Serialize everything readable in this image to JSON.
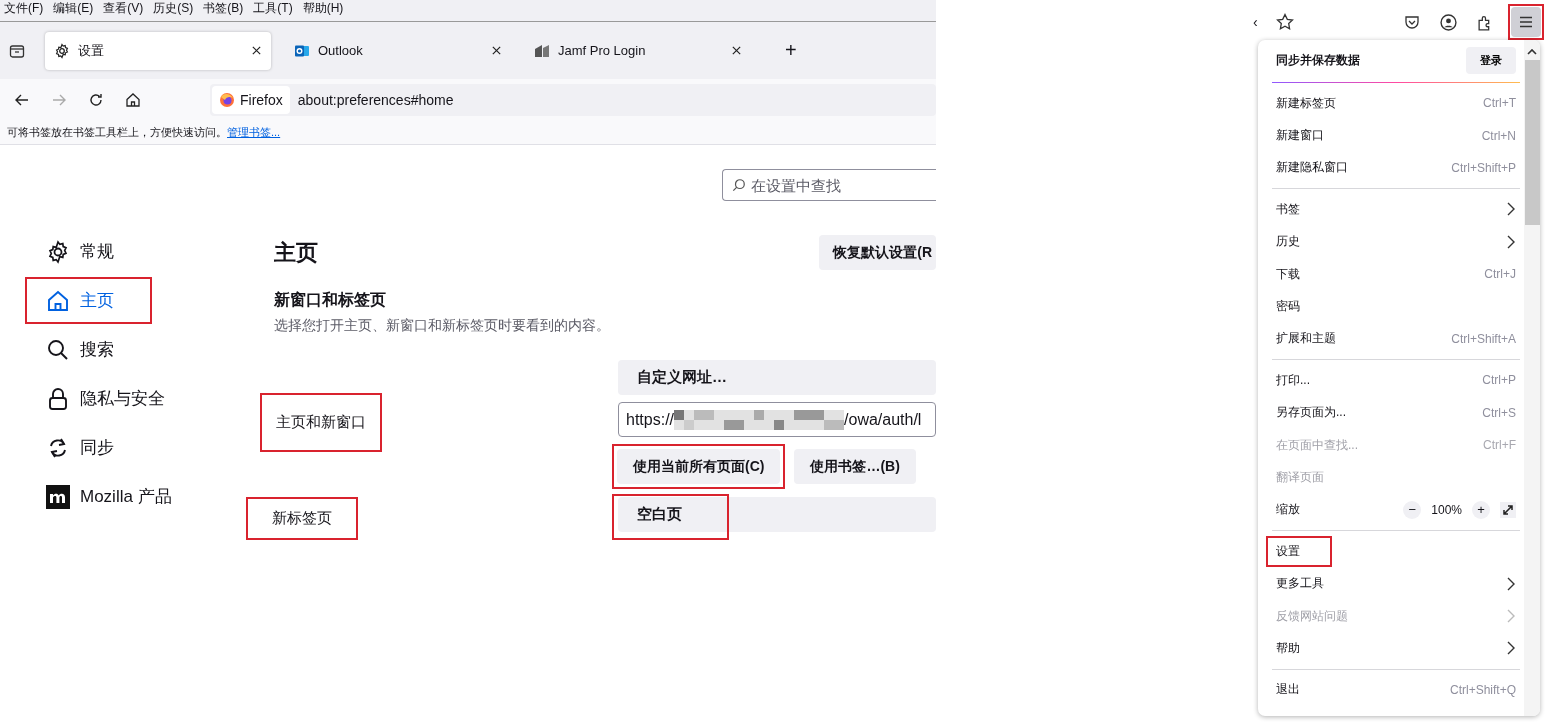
{
  "menubar": [
    "文件(F)",
    "编辑(E)",
    "查看(V)",
    "历史(S)",
    "书签(B)",
    "工具(T)",
    "帮助(H)"
  ],
  "tabs": [
    {
      "label": "设置",
      "selected": true
    },
    {
      "label": "Outlook",
      "selected": false
    },
    {
      "label": "Jamf Pro Login",
      "selected": false
    }
  ],
  "new_tab": "+",
  "address_bar": {
    "identity": "Firefox",
    "url": "about:preferences#home"
  },
  "bookmarks_bar": {
    "text": "可将书签放在书签工具栏上，方便快速访问。",
    "link": "管理书签..."
  },
  "search": {
    "placeholder": "在设置中查找"
  },
  "sidebar": [
    {
      "label": "常规",
      "selected": false,
      "highlighted": false
    },
    {
      "label": "主页",
      "selected": true,
      "highlighted": true
    },
    {
      "label": "搜索",
      "selected": false,
      "highlighted": false
    },
    {
      "label": "隐私与安全",
      "selected": false,
      "highlighted": false
    },
    {
      "label": "同步",
      "selected": false,
      "highlighted": false
    },
    {
      "label": "Mozilla 产品",
      "selected": false,
      "highlighted": false
    }
  ],
  "main": {
    "title": "主页",
    "restore_button": "恢复默认设置(R",
    "section_title": "新窗口和标签页",
    "description": "选择您打开主页、新窗口和新标签页时要看到的内容。",
    "homepage_row": {
      "label": "主页和新窗口",
      "highlighted": true,
      "dropdown": "自定义网址…",
      "url_prefix": "https://",
      "url_suffix": "/owa/auth/l",
      "url_redacted": true,
      "buttons": [
        {
          "label": "使用当前所有页面(C)",
          "highlighted": true
        },
        {
          "label": "使用书签…(B)",
          "highlighted": false
        }
      ]
    },
    "newtab_row": {
      "label": "新标签页",
      "highlighted": true,
      "dropdown": "空白页",
      "dropdown_highlighted": true
    }
  },
  "toolbar": {
    "overflow": "‹"
  },
  "menu": {
    "highlighted_button": true,
    "sync": {
      "title": "同步并保存数据",
      "button": "登录"
    },
    "items": [
      {
        "kind": "item",
        "label": "新建标签页",
        "shortcut": "Ctrl+T",
        "disabled": false,
        "submenu": false,
        "highlighted": false
      },
      {
        "kind": "item",
        "label": "新建窗口",
        "shortcut": "Ctrl+N",
        "disabled": false,
        "submenu": false,
        "highlighted": false
      },
      {
        "kind": "item",
        "label": "新建隐私窗口",
        "shortcut": "Ctrl+Shift+P",
        "disabled": false,
        "submenu": false,
        "highlighted": false
      },
      {
        "kind": "separator"
      },
      {
        "kind": "item",
        "label": "书签",
        "disabled": false,
        "submenu": true,
        "highlighted": false
      },
      {
        "kind": "item",
        "label": "历史",
        "disabled": false,
        "submenu": true,
        "highlighted": false
      },
      {
        "kind": "item",
        "label": "下载",
        "shortcut": "Ctrl+J",
        "disabled": false,
        "submenu": false,
        "highlighted": false
      },
      {
        "kind": "item",
        "label": "密码",
        "disabled": false,
        "submenu": false,
        "highlighted": false
      },
      {
        "kind": "item",
        "label": "扩展和主题",
        "shortcut": "Ctrl+Shift+A",
        "disabled": false,
        "submenu": false,
        "highlighted": false
      },
      {
        "kind": "separator"
      },
      {
        "kind": "item",
        "label": "打印...",
        "shortcut": "Ctrl+P",
        "disabled": false,
        "submenu": false,
        "highlighted": false
      },
      {
        "kind": "item",
        "label": "另存页面为...",
        "shortcut": "Ctrl+S",
        "disabled": false,
        "submenu": false,
        "highlighted": false
      },
      {
        "kind": "item",
        "label": "在页面中查找...",
        "shortcut": "Ctrl+F",
        "disabled": true,
        "submenu": false,
        "highlighted": false
      },
      {
        "kind": "item",
        "label": "翻译页面",
        "disabled": true,
        "submenu": false,
        "highlighted": false
      },
      {
        "kind": "zoom",
        "label": "缩放",
        "minus": "−",
        "value": "100%",
        "plus": "+"
      },
      {
        "kind": "separator"
      },
      {
        "kind": "item",
        "label": "设置",
        "disabled": false,
        "submenu": false,
        "highlighted": true
      },
      {
        "kind": "item",
        "label": "更多工具",
        "disabled": false,
        "submenu": true,
        "highlighted": false
      },
      {
        "kind": "item",
        "label": "反馈网站问题",
        "disabled": true,
        "submenu": true,
        "highlighted": false
      },
      {
        "kind": "item",
        "label": "帮助",
        "disabled": false,
        "submenu": true,
        "highlighted": false
      },
      {
        "kind": "separator"
      },
      {
        "kind": "item",
        "label": "退出",
        "shortcut": "Ctrl+Shift+Q",
        "disabled": false,
        "submenu": false,
        "highlighted": false
      }
    ]
  }
}
